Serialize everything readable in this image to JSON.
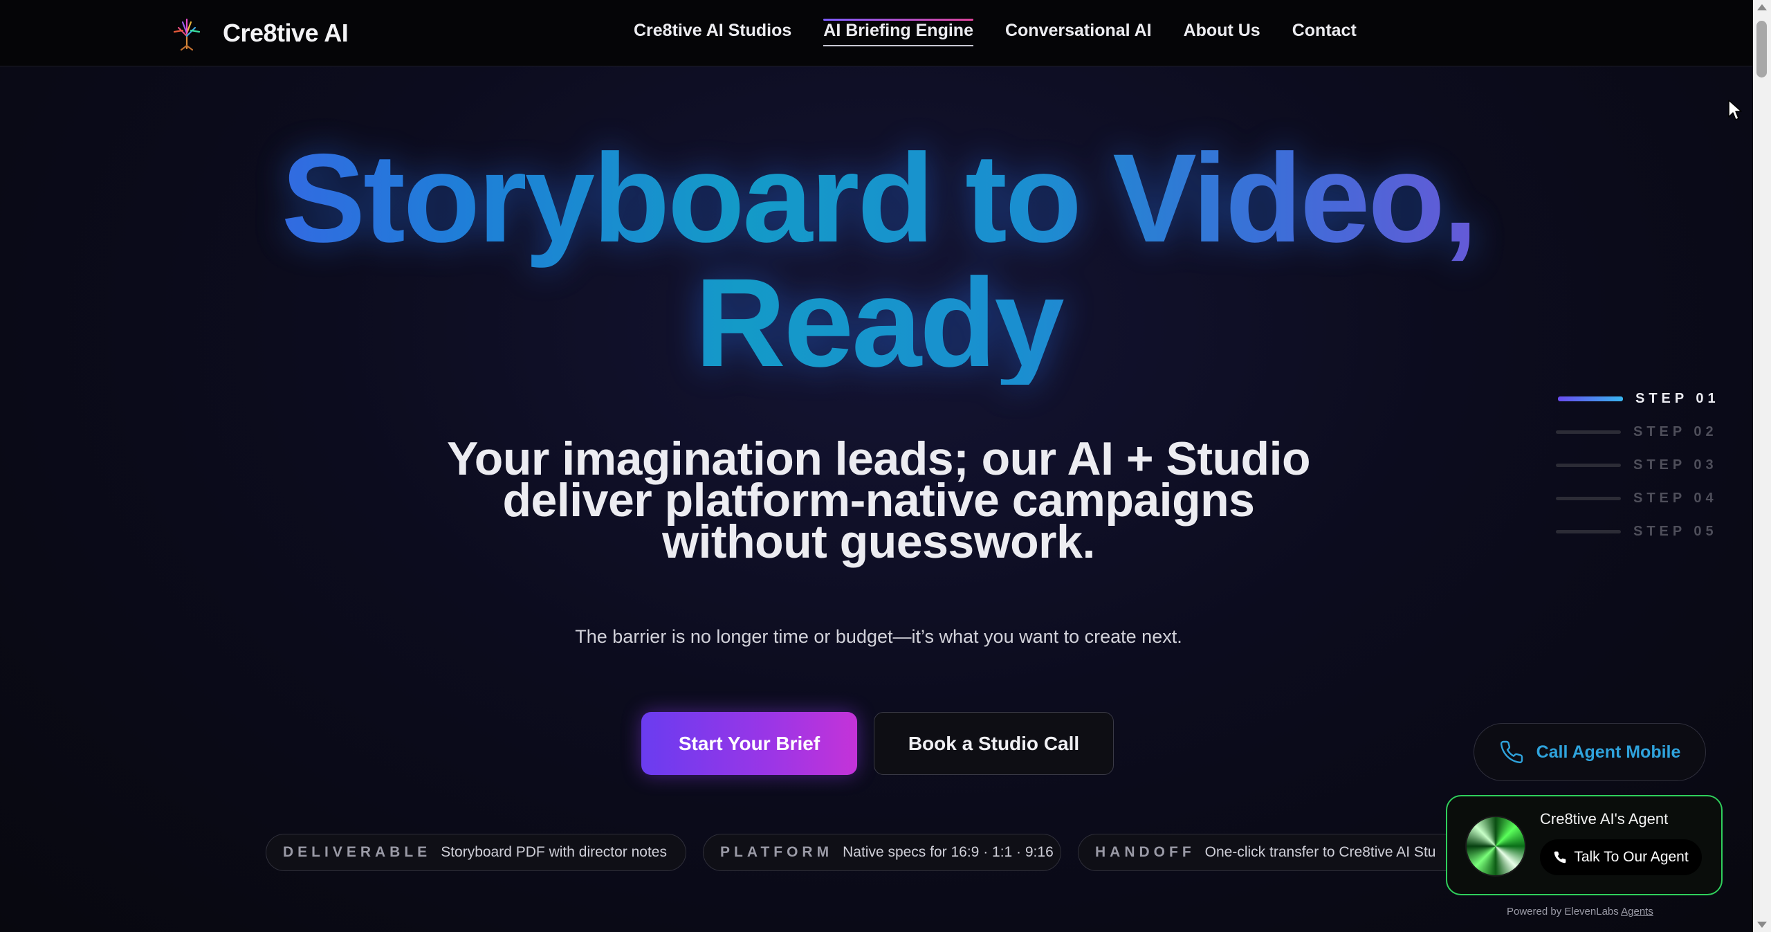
{
  "brand": {
    "name": "Cre8tive AI",
    "logo_icon": "tree-logo-icon"
  },
  "nav": {
    "items": [
      {
        "label": "Cre8tive AI Studios",
        "active": false
      },
      {
        "label": "AI Briefing Engine",
        "active": true
      },
      {
        "label": "Conversational AI",
        "active": false
      },
      {
        "label": "About Us",
        "active": false
      },
      {
        "label": "Contact",
        "active": false
      }
    ]
  },
  "hero": {
    "title_line1": "Storyboard to Video,",
    "title_line2": "Ready",
    "subtitle_line1": "Your imagination leads; our AI + Studio",
    "subtitle_line2": "deliver platform-native campaigns",
    "subtitle_line3": "without guesswork.",
    "tagline": "The barrier is no longer time or budget—it’s what you want to create next.",
    "primary_cta": "Start Your Brief",
    "secondary_cta": "Book a Studio Call"
  },
  "pills": [
    {
      "key": "DELIVERABLE",
      "value": "Storyboard PDF with director notes"
    },
    {
      "key": "PLATFORM",
      "value": "Native specs for 16:9 · 1:1 · 9:16"
    },
    {
      "key": "HANDOFF",
      "value": "One-click transfer to Cre8tive AI Stu"
    }
  ],
  "steps": [
    {
      "label": "STEP 01",
      "active": true
    },
    {
      "label": "STEP 02",
      "active": false
    },
    {
      "label": "STEP 03",
      "active": false
    },
    {
      "label": "STEP 04",
      "active": false
    },
    {
      "label": "STEP 05",
      "active": false
    }
  ],
  "call_mobile": {
    "label": "Call Agent Mobile",
    "icon": "phone-icon"
  },
  "agent_widget": {
    "title": "Cre8tive AI's Agent",
    "talk_button": "Talk To Our Agent",
    "powered_prefix": "Powered by ElevenLabs",
    "powered_link": "Agents"
  },
  "colors": {
    "accent_purple": "#6a3cf0",
    "accent_magenta": "#c433d8",
    "title_blue": "#1f7ed8",
    "agent_green": "#2fcf5c",
    "call_blue": "#2fa3dc"
  }
}
